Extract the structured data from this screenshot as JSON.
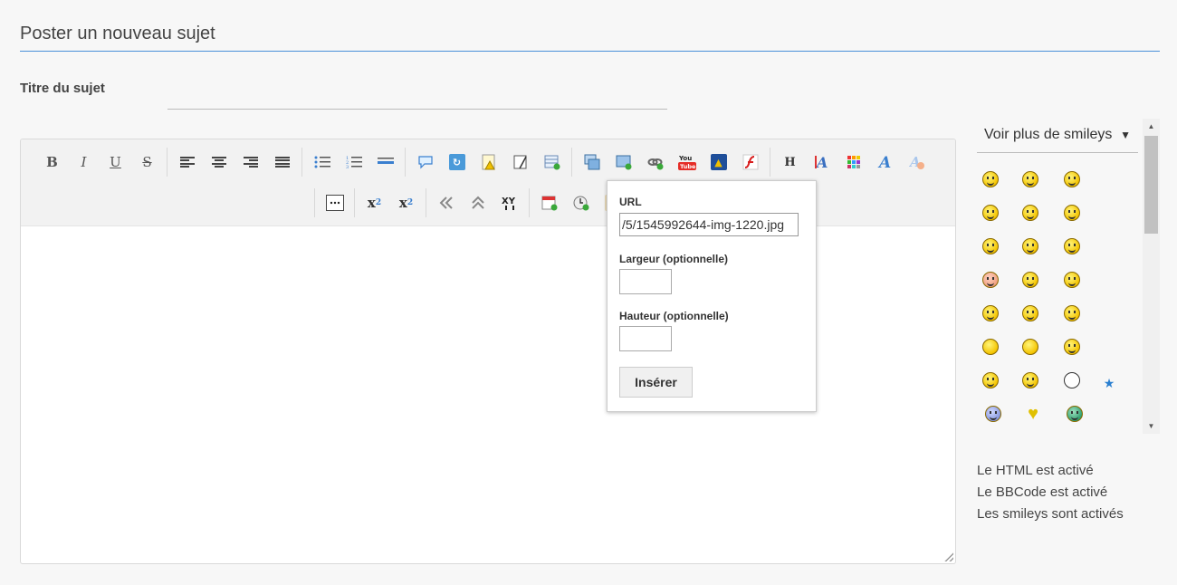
{
  "page": {
    "heading": "Poster un nouveau sujet"
  },
  "topic": {
    "label": "Titre du sujet",
    "value": ""
  },
  "toolbar": {
    "bold": "B",
    "italic": "I",
    "underline": "U",
    "strike": "S",
    "subscript": "x",
    "sub_mark": "2",
    "superscript": "x",
    "sup_mark": "2",
    "header": "H"
  },
  "image_popup": {
    "url_label": "URL",
    "url_value": "/5/1545992644-img-1220.jpg",
    "width_label": "Largeur (optionnelle)",
    "height_label": "Hauteur (optionnelle)",
    "insert_button": "Insérer"
  },
  "smileys": {
    "dropdown_label": "Voir plus de smileys",
    "arrow": "▼"
  },
  "status": {
    "html": "Le HTML est activé",
    "bbcode": "Le BBCode est activé",
    "smileys": "Les smileys sont activés"
  },
  "colors": {
    "accent": "#4a90d9",
    "background": "#f7f7f7",
    "youtube": "#e52d27"
  }
}
